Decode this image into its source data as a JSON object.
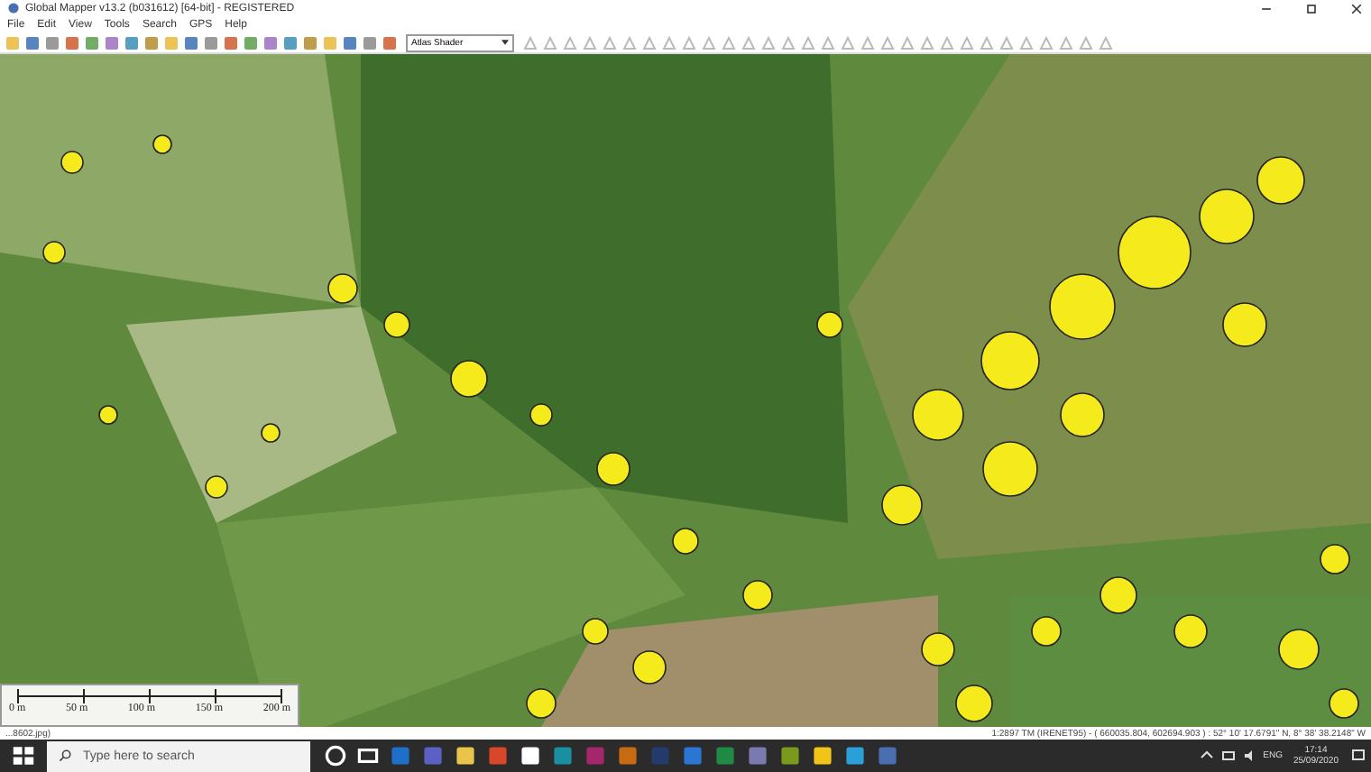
{
  "window": {
    "title": "Global Mapper v13.2 (b031612) [64-bit] - REGISTERED"
  },
  "menu": [
    "File",
    "Edit",
    "View",
    "Tools",
    "Search",
    "GPS",
    "Help"
  ],
  "toolbar": {
    "shader": "Atlas Shader"
  },
  "scale_bar": {
    "labels": [
      "0 m",
      "50 m",
      "100 m",
      "150 m",
      "200 m"
    ]
  },
  "status_bar": {
    "file": "...8602.jpg)",
    "position": "1:2897  TM (IRENET95) - ( 660035.804, 602694.903 ) : 52° 10' 17.6791\" N, 8° 38' 38.2148\" W"
  },
  "taskbar": {
    "search_placeholder": "Type here to search",
    "language": "ENG",
    "time": "17:14",
    "date": "25/09/2020"
  }
}
